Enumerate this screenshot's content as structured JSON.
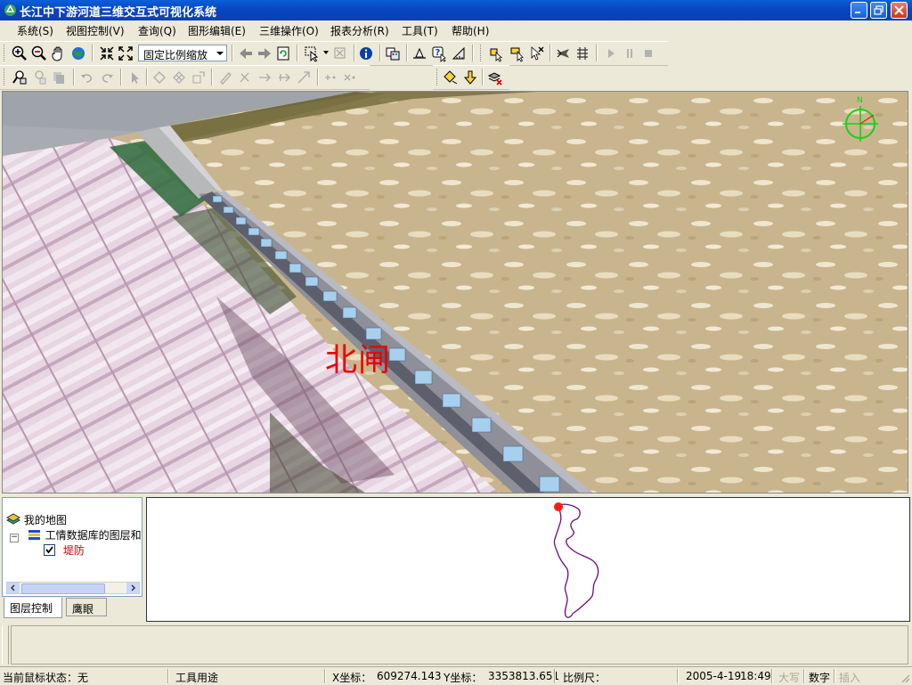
{
  "window": {
    "title": "长江中下游河道三维交互式可视化系统"
  },
  "menu": [
    {
      "id": "system",
      "label": "系统(S)"
    },
    {
      "id": "view",
      "label": "视图控制(V)"
    },
    {
      "id": "query",
      "label": "查询(Q)"
    },
    {
      "id": "edit",
      "label": "图形编辑(E)"
    },
    {
      "id": "three_d",
      "label": "三维操作(O)"
    },
    {
      "id": "report",
      "label": "报表分析(R)"
    },
    {
      "id": "tools",
      "label": "工具(T)"
    },
    {
      "id": "help",
      "label": "帮助(H)"
    }
  ],
  "toolbar": {
    "zoom_combo_value": "固定比例缩放"
  },
  "viewport": {
    "label": "北闸",
    "compass_label": "N",
    "label_color": "#ee0000"
  },
  "tree": {
    "root": "我的地图",
    "group": "工情数据库的图层和|",
    "layer": "堤防",
    "layer_checked": true,
    "layer_color": "#cc0000"
  },
  "tabs": {
    "layers": "图层控制",
    "eagle": "鹰眼"
  },
  "status": {
    "mouse_state": "当前鼠标状态：无",
    "tool_use": "工具用途",
    "x_label": "X坐标：",
    "x_value": "609274.143",
    "y_label": "Y坐标：",
    "y_value": "3353813.651",
    "scale_label": "比例尺：",
    "date": "2005-4-19",
    "time": "18:49",
    "caps": "大写",
    "num": "数字",
    "insert": "插入"
  }
}
